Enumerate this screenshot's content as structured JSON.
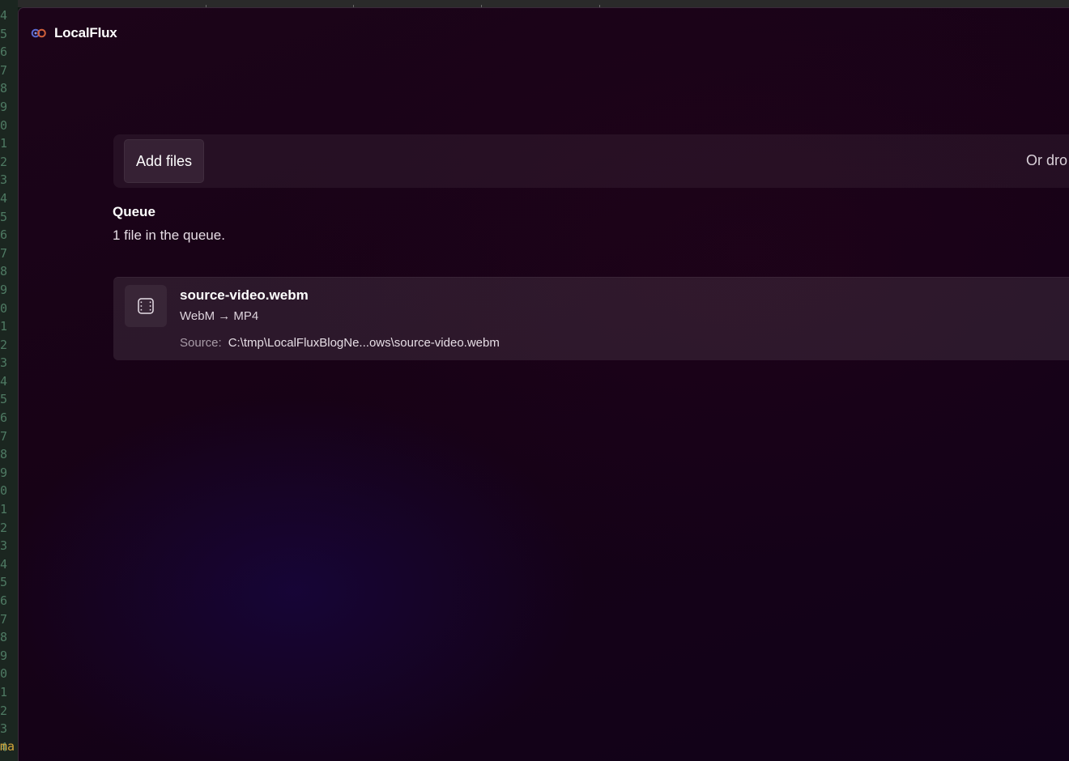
{
  "background": {
    "gutter_numbers": [
      "4",
      "5",
      "6",
      "7",
      "8",
      "9",
      "0",
      "1",
      "2",
      "3",
      "4",
      "5",
      "6",
      "7",
      "8",
      "9",
      "0",
      "1",
      "2",
      "3",
      "4",
      "5",
      "6",
      "7",
      "8",
      "9",
      "0",
      "1",
      "2",
      "3",
      "4",
      "5",
      "6",
      "7",
      "8",
      "9",
      "0",
      "1",
      "2",
      "3",
      "4"
    ],
    "code_tail": "ma"
  },
  "app": {
    "title": "LocalFlux",
    "icon": "localflux-logo-icon",
    "accent": "#ffffff",
    "background": "#170216"
  },
  "toolbar": {
    "add_files_label": "Add files",
    "drop_hint": "Or dro"
  },
  "queue": {
    "heading": "Queue",
    "count_text": "1 file in the queue.",
    "items": [
      {
        "icon": "video-file-icon",
        "name": "source-video.webm",
        "conversion": "WebM → MP4",
        "source_label": "Source:",
        "source_path": "C:\\tmp\\LocalFluxBlogNe...ows\\source-video.webm"
      }
    ]
  }
}
